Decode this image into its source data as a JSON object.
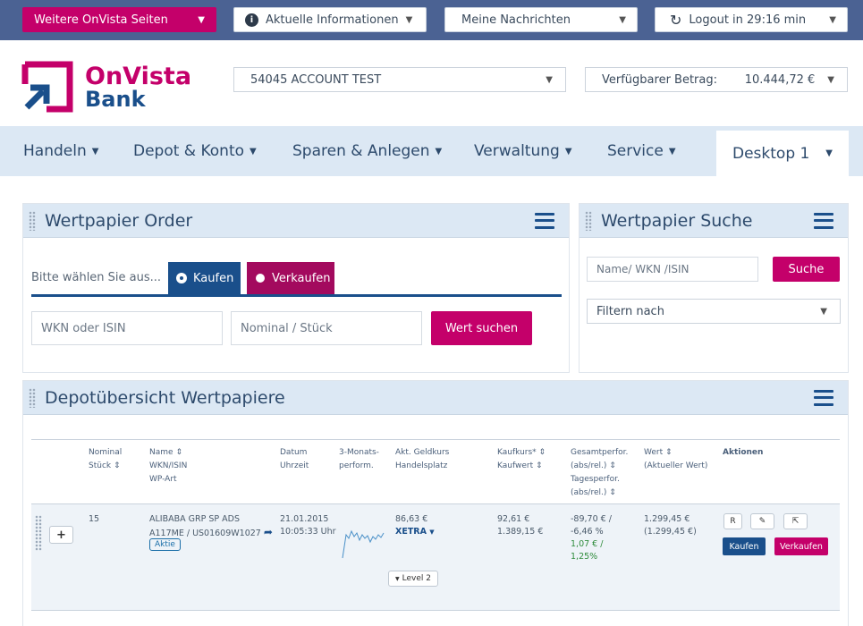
{
  "topbar": {
    "more_pages": "Weitere OnVista Seiten",
    "info": "Aktuelle Informationen",
    "messages": "Meine Nachrichten",
    "logout": "Logout in 29:16 min"
  },
  "brand": {
    "line1": "OnVista",
    "line2": "Bank"
  },
  "account": {
    "selected": "54045 ACCOUNT TEST",
    "available_label": "Verfügbarer Betrag:",
    "available_value": "10.444,72 €"
  },
  "nav": {
    "items": [
      "Handeln",
      "Depot & Konto",
      "Sparen & Anlegen",
      "Verwaltung",
      "Service"
    ],
    "desktop": "Desktop 1"
  },
  "order": {
    "title": "Wertpapier Order",
    "prompt": "Bitte wählen Sie aus...",
    "buy": "Kaufen",
    "sell": "Verkaufen",
    "wkn_placeholder": "WKN oder ISIN",
    "nominal_placeholder": "Nominal / Stück",
    "search_button": "Wert suchen"
  },
  "search": {
    "title": "Wertpapier Suche",
    "placeholder": "Name/ WKN /ISIN",
    "button": "Suche",
    "filter": "Filtern nach"
  },
  "depot": {
    "title": "Depotübersicht Wertpapiere",
    "headers": {
      "nominal": "Nominal",
      "stueck": "Stück",
      "name": "Name",
      "wkn": "WKN/ISIN",
      "wpart": "WP-Art",
      "datum": "Datum",
      "uhrzeit": "Uhrzeit",
      "perf1": "3-Monats-",
      "perf2": "perform.",
      "geld": "Akt. Geldkurs",
      "platz": "Handelsplatz",
      "kaufkurs": "Kaufkurs*",
      "kaufwert": "Kaufwert",
      "gesamt1": "Gesamtperfor.",
      "gesamt2": "(abs/rel.)",
      "tages1": "Tagesperfor.",
      "tages2": "(abs/rel.)",
      "wert": "Wert",
      "wert2": "(Aktueller Wert)",
      "aktionen": "Aktionen"
    },
    "row": {
      "nominal": "15",
      "name": "ALIBABA GRP SP ADS",
      "wkn": "A117ME / US01609W1027",
      "art": "Aktie",
      "datum": "21.01.2015",
      "zeit": "10:05:33 Uhr",
      "geldkurs": "86,63 €",
      "platz": "XETRA",
      "level": "Level 2",
      "kaufkurs": "92,61 €",
      "kaufwert": "1.389,15 €",
      "gesamt_abs": "-89,70 € /",
      "gesamt_rel": "-6,46 %",
      "tages_abs": "1,07 € /",
      "tages_rel": "1,25%",
      "wert": "1.299,45 €",
      "wert2": "(1.299,45 €)",
      "r": "R",
      "kaufen": "Kaufen",
      "verkaufen": "Verkaufen"
    }
  },
  "colors": {
    "brand_pink": "#c4006a",
    "brand_blue": "#1a4f8b",
    "topbar": "#4b6293"
  }
}
